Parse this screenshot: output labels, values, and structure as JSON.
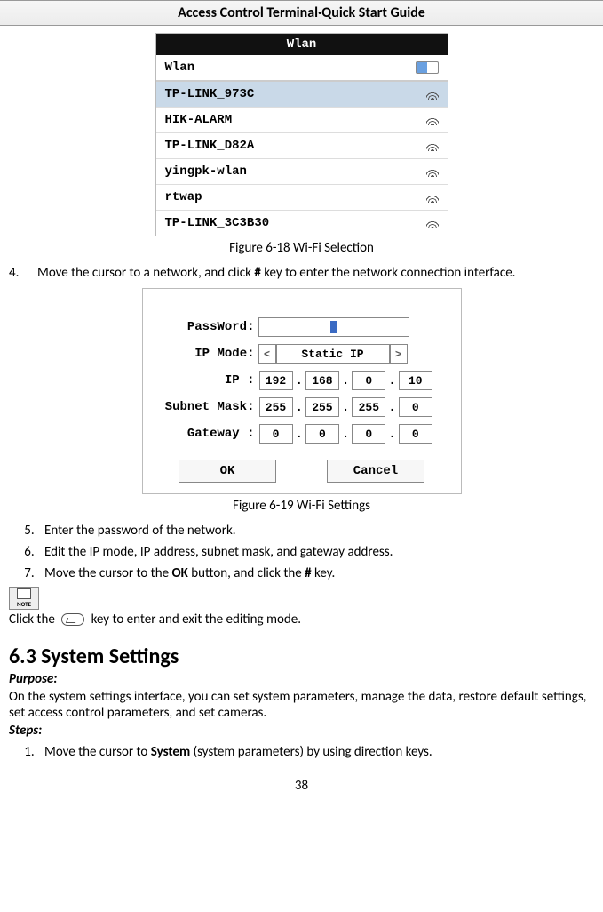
{
  "header": "Access Control Terminal·Quick Start Guide",
  "fig1": {
    "title": "Wlan",
    "toggle_row_label": "Wlan",
    "networks": [
      {
        "ssid": "TP-LINK_973C",
        "selected": true
      },
      {
        "ssid": "HIK-ALARM",
        "selected": false
      },
      {
        "ssid": "TP-LINK_D82A",
        "selected": false
      },
      {
        "ssid": "yingpk-wlan",
        "selected": false
      },
      {
        "ssid": "rtwap",
        "selected": false
      },
      {
        "ssid": "TP-LINK_3C3B30",
        "selected": false
      }
    ],
    "caption_prefix": "Figure 6-18",
    "caption_text": "Wi-Fi Selection"
  },
  "step4": {
    "num": "4.",
    "text_a": "Move the cursor to a network, and click ",
    "key": "#",
    "text_b": " key to enter the network connection interface."
  },
  "fig2": {
    "labels": {
      "password": "PassWord:",
      "ipmode": "IP Mode:",
      "ip": "IP    :",
      "subnet": "Subnet Mask:",
      "gateway": "Gateway :"
    },
    "ipmode_value": "Static IP",
    "ip": [
      "192",
      "168",
      "0",
      "10"
    ],
    "subnet": [
      "255",
      "255",
      "255",
      "0"
    ],
    "gateway": [
      "0",
      "0",
      "0",
      "0"
    ],
    "ok": "OK",
    "cancel": "Cancel",
    "caption_prefix": "Figure 6-19",
    "caption_text": "Wi-Fi Settings"
  },
  "step5": "Enter the password of the network.",
  "step6": "Edit the IP mode, IP address, subnet mask, and gateway address.",
  "step7": {
    "a": "Move the cursor to the ",
    "ok": "OK",
    "b": " button, and click the ",
    "key": "#",
    "c": " key."
  },
  "note_label": "NOTE",
  "note_line": {
    "a": "Click the ",
    "b": " key to enter and exit the editing mode."
  },
  "section": {
    "heading": "6.3 System Settings",
    "purpose_lbl": "Purpose:",
    "purpose_text": "On the system settings interface, you can set system parameters, manage the data, restore default settings, set access control parameters, and set cameras.",
    "steps_lbl": "Steps:",
    "step1": {
      "a": "Move the cursor to ",
      "sys": "System",
      "b": " (system parameters) by using direction keys."
    }
  },
  "page_number": "38"
}
